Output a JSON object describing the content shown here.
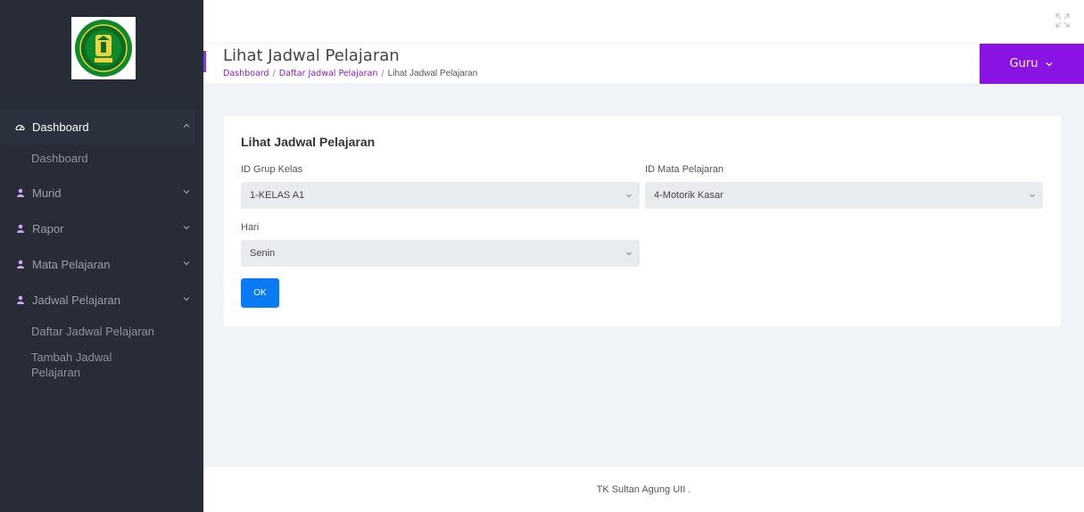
{
  "sidebar": {
    "logo_alt": "TK Sultan Agung UII logo",
    "items": [
      {
        "label": "Dashboard",
        "icon": "dashboard-icon",
        "expanded": true
      },
      {
        "label": "Murid",
        "icon": "user-icon",
        "expanded": false
      },
      {
        "label": "Rapor",
        "icon": "user-icon",
        "expanded": false
      },
      {
        "label": "Mata Pelajaran",
        "icon": "user-icon",
        "expanded": false
      },
      {
        "label": "Jadwal Pelajaran",
        "icon": "user-icon",
        "expanded": false
      }
    ],
    "sub_dashboard": "Dashboard",
    "sub_jadwal": [
      "Daftar Jadwal Pelajaran",
      "Tambah Jadwal Pelajaran"
    ]
  },
  "header": {
    "title": "Lihat Jadwal Pelajaran",
    "breadcrumb": [
      "Dashboard",
      "Daftar Jadwal Pelajaran",
      "Lihat Jadwal Pelajaran"
    ],
    "user_menu": "Guru"
  },
  "form": {
    "title": "Lihat Jadwal Pelajaran",
    "grup_kelas_label": "ID Grup Kelas",
    "grup_kelas_value": "1-KELAS A1",
    "mapel_label": "ID Mata Pelajaran",
    "mapel_value": "4-Motorik Kasar",
    "hari_label": "Hari",
    "hari_value": "Senin",
    "submit_label": "OK"
  },
  "footer": {
    "text": "TK Sultan Agung UII ."
  },
  "colors": {
    "sidebar": "#272c36",
    "accent": "#8a12e2",
    "primary_button": "#0a7bf5",
    "background": "#f1f4f7"
  }
}
